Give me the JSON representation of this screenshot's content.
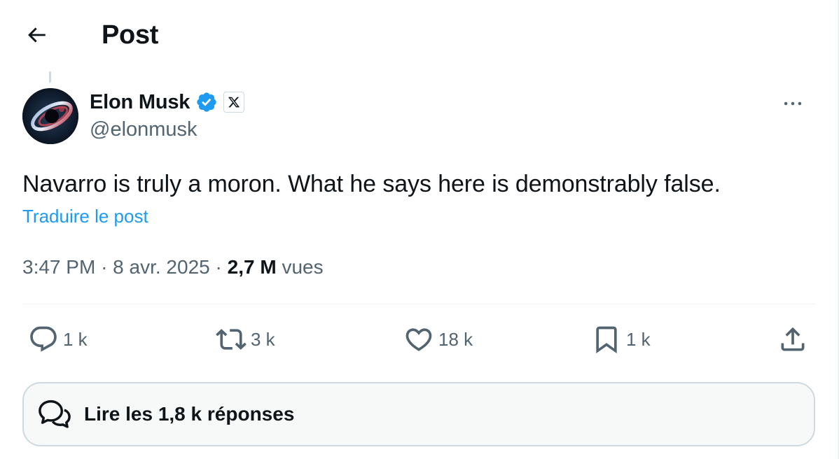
{
  "header": {
    "title": "Post",
    "back_icon": "arrow-left-icon"
  },
  "author": {
    "display_name": "Elon Musk",
    "handle": "@elonmusk",
    "verified_icon": "verified-badge-icon",
    "affiliation_icon": "x-logo-icon",
    "more_icon": "more-horizontal-icon"
  },
  "tweet": {
    "text": "Navarro is truly a moron. What he says here is demonstrably false.",
    "translate_label": "Traduire le post",
    "time": "3:47 PM",
    "separator": "·",
    "date": "8 avr. 2025",
    "views_count": "2,7 M",
    "views_label": "vues"
  },
  "actions": {
    "reply": {
      "icon": "reply-icon",
      "count": "1 k"
    },
    "repost": {
      "icon": "repost-icon",
      "count": "3 k"
    },
    "like": {
      "icon": "heart-icon",
      "count": "18 k"
    },
    "bookmark": {
      "icon": "bookmark-icon",
      "count": "1 k"
    },
    "share": {
      "icon": "share-icon"
    }
  },
  "replies_button": {
    "label": "Lire les 1,8 k réponses",
    "icon": "chat-bubbles-icon"
  },
  "colors": {
    "accent": "#1d9bf0",
    "text_primary": "#0f1419",
    "text_secondary": "#536471",
    "border": "#cfd9de"
  }
}
